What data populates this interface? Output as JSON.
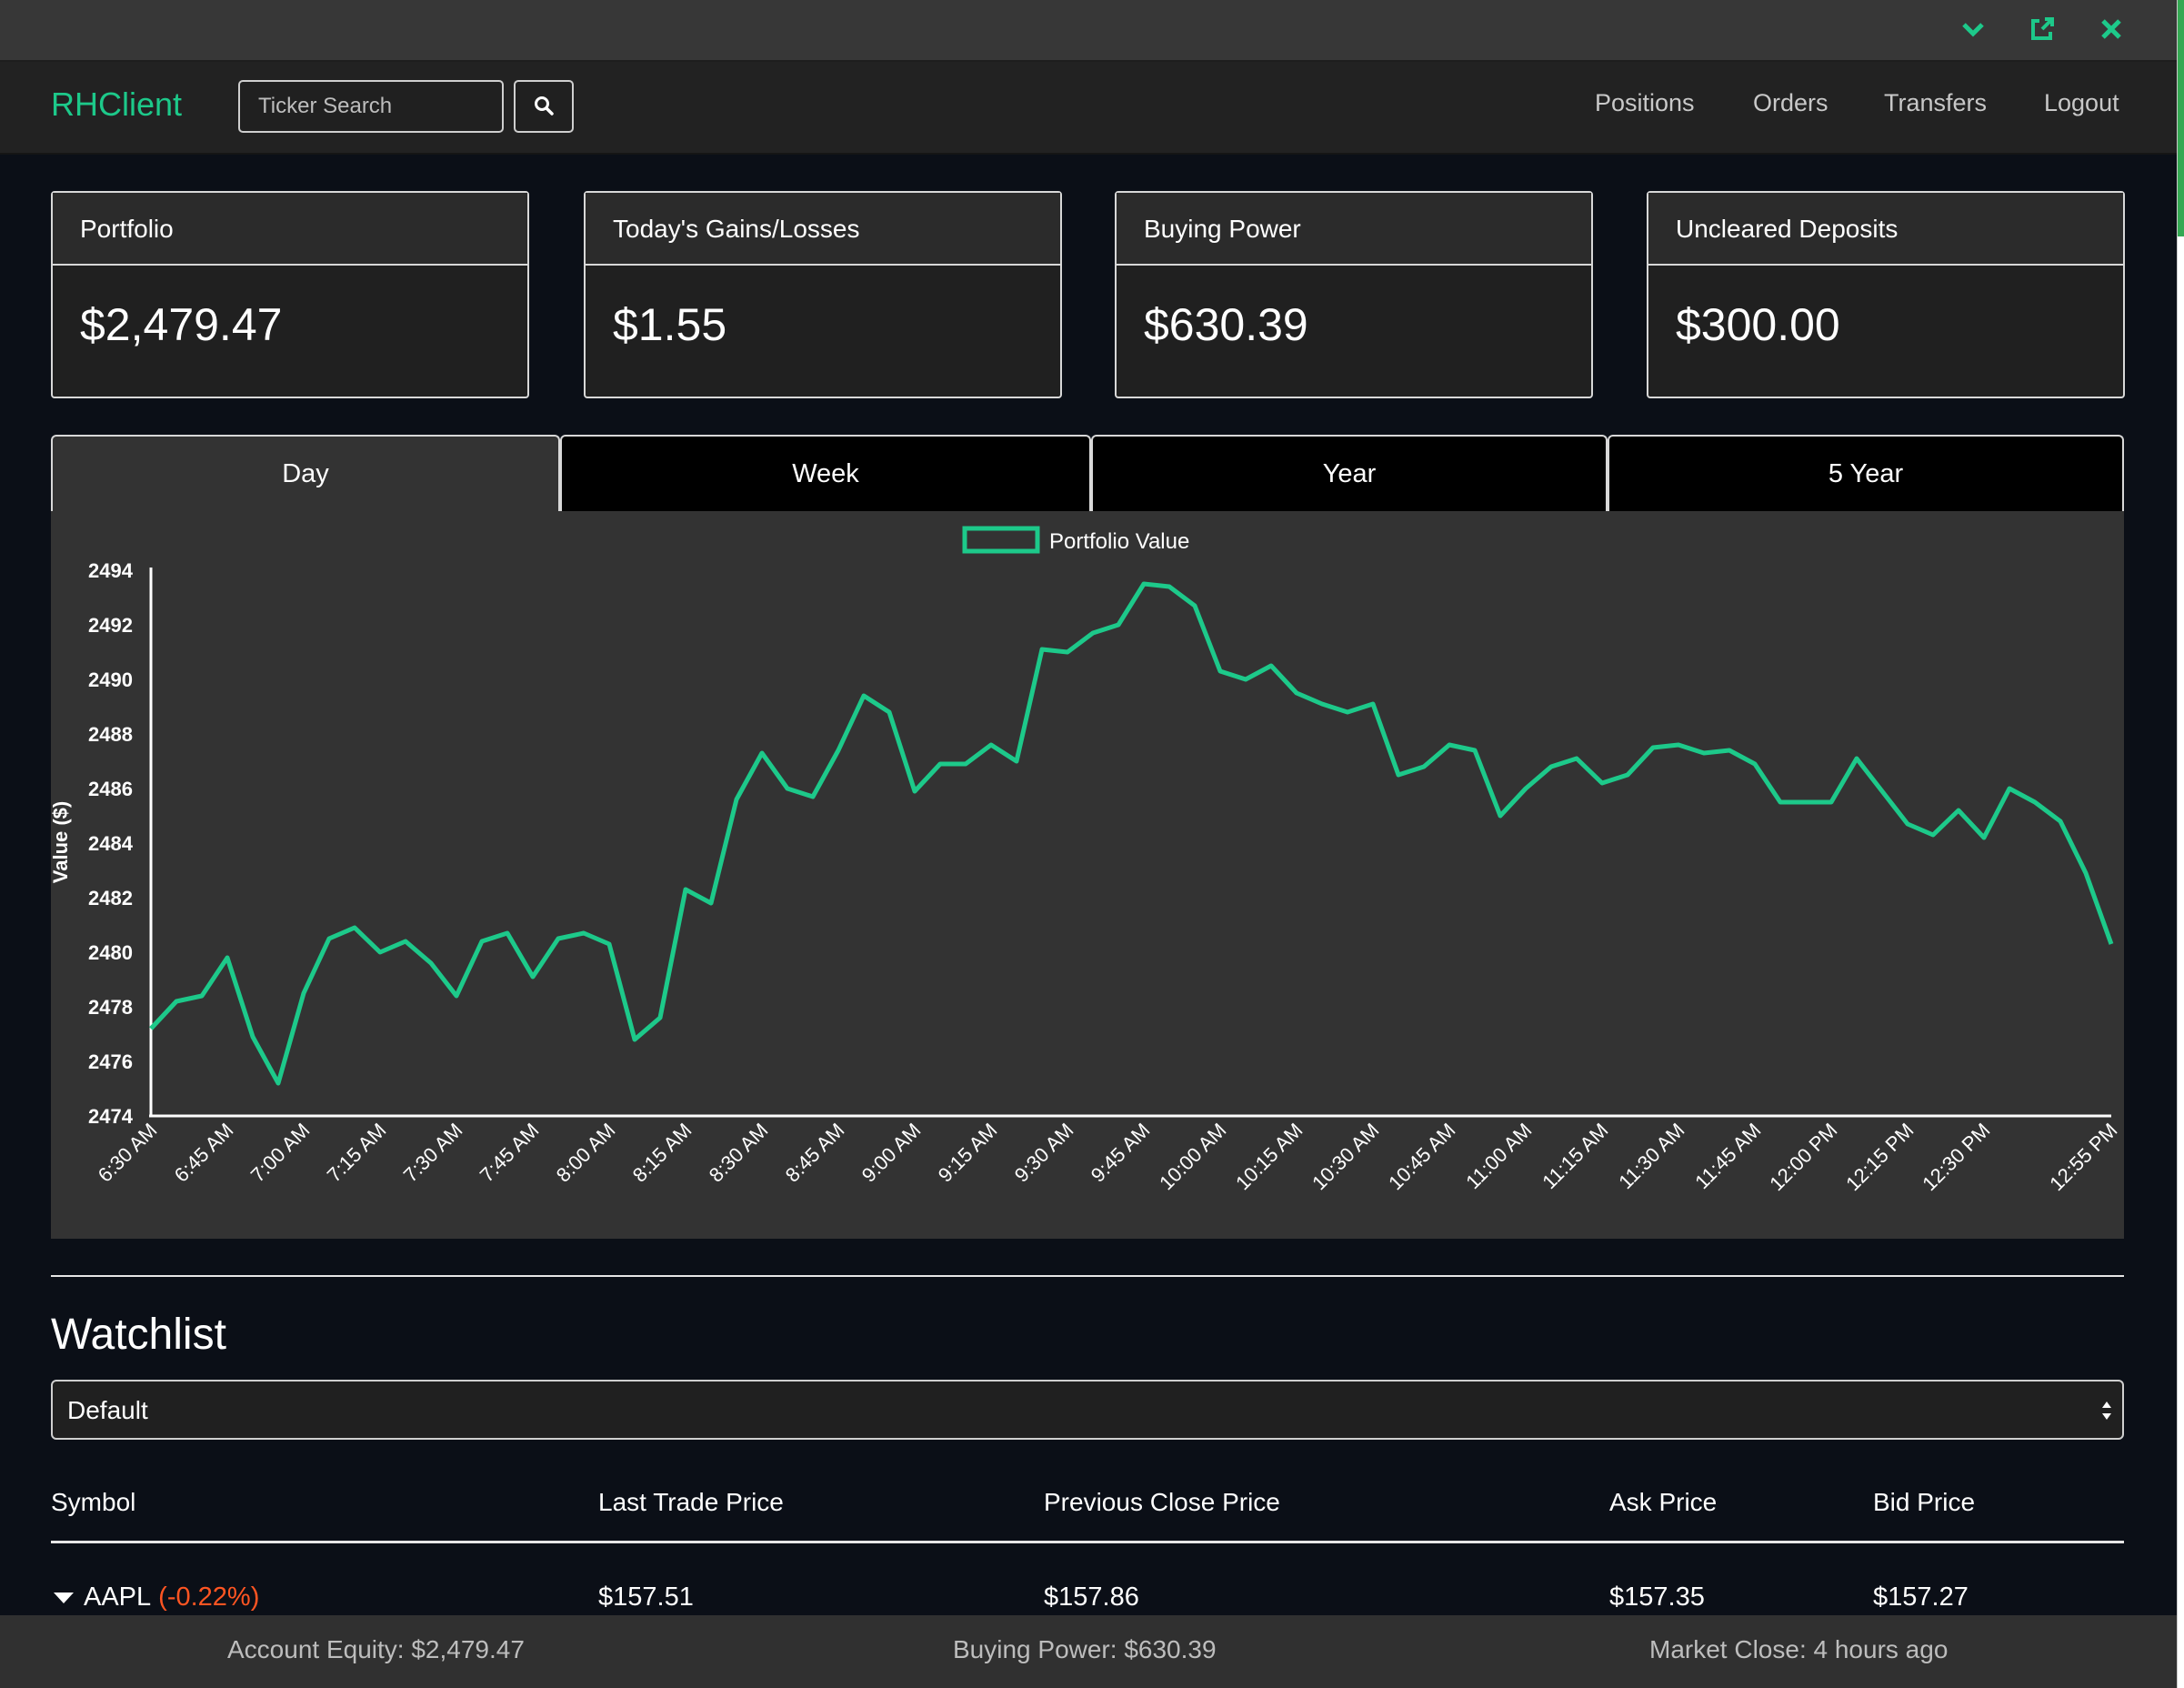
{
  "navbar": {
    "brand": "RHClient",
    "search_placeholder": "Ticker Search",
    "links": [
      "Positions",
      "Orders",
      "Transfers",
      "Logout"
    ]
  },
  "colors": {
    "accent": "#1dc98a",
    "negative": "#ff5522",
    "background": "#0b0f17"
  },
  "window_controls": [
    "chevron-down-icon",
    "popout-icon",
    "close-icon"
  ],
  "cards": [
    {
      "label": "Portfolio",
      "value": "$2,479.47"
    },
    {
      "label": "Today's Gains/Losses",
      "value": "$1.55"
    },
    {
      "label": "Buying Power",
      "value": "$630.39"
    },
    {
      "label": "Uncleared Deposits",
      "value": "$300.00"
    }
  ],
  "tabs": [
    {
      "label": "Day",
      "active": true
    },
    {
      "label": "Week",
      "active": false
    },
    {
      "label": "Year",
      "active": false
    },
    {
      "label": "5 Year",
      "active": false
    }
  ],
  "chart_data": {
    "type": "line",
    "title": "",
    "xlabel": "",
    "ylabel": "Value ($)",
    "ylim": [
      2474,
      2494
    ],
    "yticks": [
      2474,
      2476,
      2478,
      2480,
      2482,
      2484,
      2486,
      2488,
      2490,
      2492,
      2494
    ],
    "xtick_labels": [
      "6:30 AM",
      "6:45 AM",
      "7:00 AM",
      "7:15 AM",
      "7:30 AM",
      "7:45 AM",
      "8:00 AM",
      "8:15 AM",
      "8:30 AM",
      "8:45 AM",
      "9:00 AM",
      "9:15 AM",
      "9:30 AM",
      "9:45 AM",
      "10:00 AM",
      "10:15 AM",
      "10:30 AM",
      "10:45 AM",
      "11:00 AM",
      "11:15 AM",
      "11:30 AM",
      "11:45 AM",
      "12:00 PM",
      "12:15 PM",
      "12:30 PM",
      "12:55 PM"
    ],
    "legend": "top-center",
    "grid": false,
    "series": [
      {
        "name": "Portfolio Value",
        "color": "#1dc98a",
        "values": [
          2477.2,
          2478.2,
          2478.4,
          2479.8,
          2476.9,
          2475.2,
          2478.5,
          2480.5,
          2480.9,
          2480.0,
          2480.4,
          2479.6,
          2478.4,
          2480.4,
          2480.7,
          2479.1,
          2480.5,
          2480.7,
          2480.3,
          2476.8,
          2477.6,
          2482.3,
          2481.8,
          2485.6,
          2487.3,
          2486.0,
          2485.7,
          2487.4,
          2489.4,
          2488.8,
          2485.9,
          2486.9,
          2486.9,
          2487.6,
          2487.0,
          2491.1,
          2491.0,
          2491.7,
          2492.0,
          2493.5,
          2493.4,
          2492.7,
          2490.3,
          2490.0,
          2490.5,
          2489.5,
          2489.1,
          2488.8,
          2489.1,
          2486.5,
          2486.8,
          2487.6,
          2487.4,
          2485.0,
          2486.0,
          2486.8,
          2487.1,
          2486.2,
          2486.5,
          2487.5,
          2487.6,
          2487.3,
          2487.4,
          2486.9,
          2485.5,
          2485.5,
          2485.5,
          2487.1,
          2485.9,
          2484.7,
          2484.3,
          2485.2,
          2484.2,
          2486.0,
          2485.5,
          2484.8,
          2482.9,
          2480.3
        ]
      }
    ]
  },
  "watchlist": {
    "title": "Watchlist",
    "selected": "Default",
    "columns": [
      "Symbol",
      "Last Trade Price",
      "Previous Close Price",
      "Ask Price",
      "Bid Price"
    ],
    "rows": [
      {
        "symbol": "AAPL",
        "change": "(-0.22%)",
        "last": "$157.51",
        "prev_close": "$157.86",
        "ask": "$157.35",
        "bid": "$157.27"
      }
    ]
  },
  "footer": {
    "equity": "Account Equity: $2,479.47",
    "buying_power": "Buying Power: $630.39",
    "market_close": "Market Close: 4 hours ago"
  }
}
